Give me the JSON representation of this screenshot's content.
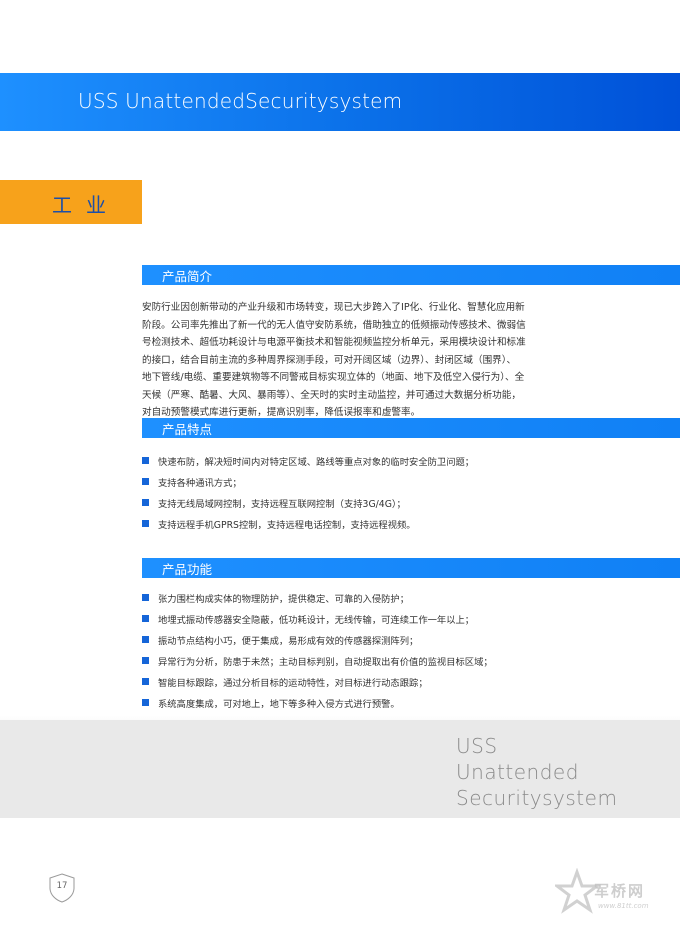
{
  "banner": {
    "title": "USS UnattendedSecuritysystem"
  },
  "industry": {
    "label": "工业"
  },
  "intro_section": {
    "heading": "产品简介",
    "lines": [
      "安防行业因创新带动的产业升级和市场转变，现已大步跨入了IP化、行业化、智慧化应用新",
      "阶段。公司率先推出了新一代的无人值守安防系统，借助独立的低频振动传感技术、微弱信",
      "号检测技术、超低功耗设计与电源平衡技术和智能视频监控分析单元，采用模块设计和标准",
      "的接口，结合目前主流的多种周界探测手段，可对开阔区域（边界）、封闭区域（围界）、",
      "地下管线/电缆、重要建筑物等不同警戒目标实现立体的（地面、地下及低空入侵行为）、全",
      "天候（严寒、酷暑、大风、暴雨等）、全天时的实时主动监控，并可通过大数据分析功能，",
      "对自动预警模式库进行更新，提高识别率，降低误报率和虚警率。"
    ]
  },
  "features_section": {
    "heading": "产品特点",
    "items": [
      "快速布防，解决短时间内对特定区域、路线等重点对象的临时安全防卫问题；",
      "支持各种通讯方式；",
      "支持无线局域网控制，支持远程互联网控制（支持3G/4G）；",
      "支持远程手机GPRS控制，支持远程电话控制，支持远程视频。"
    ]
  },
  "functions_section": {
    "heading": "产品功能",
    "items": [
      "张力围栏构成实体的物理防护，提供稳定、可靠的入侵防护；",
      "地埋式振动传感器安全隐蔽，低功耗设计，无线传输，可连续工作一年以上；",
      "振动节点结构小巧，便于集成，易形成有效的传感器探测阵列；",
      "异常行为分析，防患于未然；主动目标判别，自动提取出有价值的监视目标区域；",
      "智能目标跟踪，通过分析目标的运动特性，对目标进行动态跟踪；",
      "系统高度集成，可对地上，地下等多种入侵方式进行预警。"
    ]
  },
  "footer_brand": {
    "lines": [
      "USS",
      "Unattended",
      "Securitysystem"
    ]
  },
  "page": {
    "number": "17"
  },
  "watermark": {
    "brand": "军桥网",
    "url": "www.81tt.com"
  },
  "colors": {
    "accent_blue": "#1e90ff",
    "dark_blue": "#0051d8",
    "orange": "#f7a21b",
    "bullet_blue": "#1565d8",
    "gray_band": "#e9e9e9"
  },
  "icons": {
    "bullet": "blue-square-bullet",
    "page_badge": "shield-outline-icon",
    "watermark_logo": "star-logo-icon"
  }
}
